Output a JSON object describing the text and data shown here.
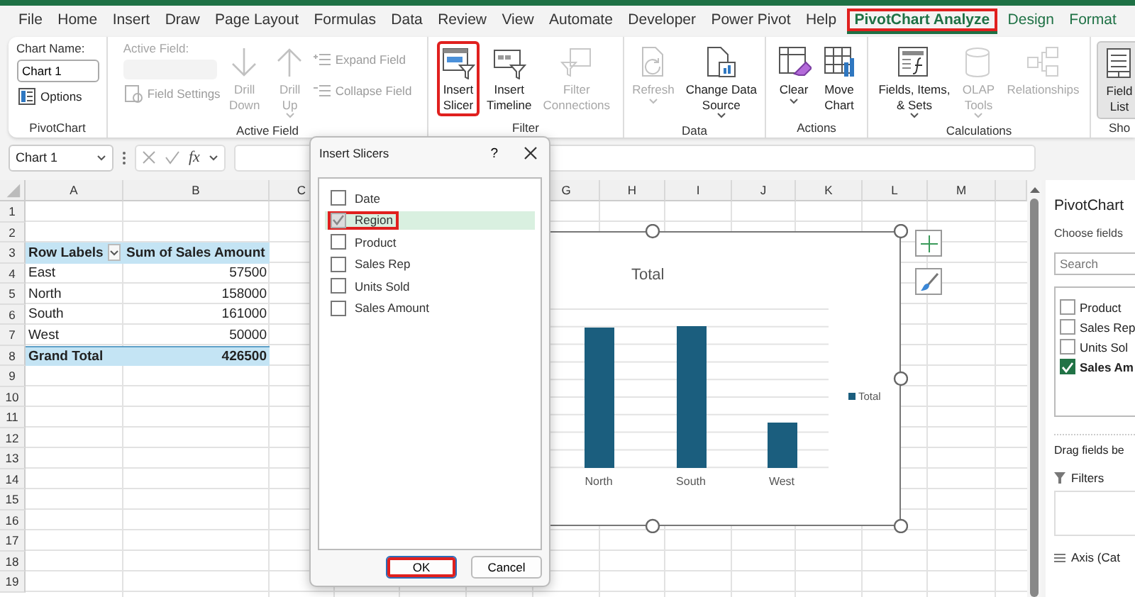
{
  "menu": [
    {
      "label": "File",
      "selected": false,
      "contextual": false,
      "highlighted": false
    },
    {
      "label": "Home",
      "selected": false,
      "contextual": false,
      "highlighted": false
    },
    {
      "label": "Insert",
      "selected": false,
      "contextual": false,
      "highlighted": false
    },
    {
      "label": "Draw",
      "selected": false,
      "contextual": false,
      "highlighted": false
    },
    {
      "label": "Page Layout",
      "selected": false,
      "contextual": false,
      "highlighted": false
    },
    {
      "label": "Formulas",
      "selected": false,
      "contextual": false,
      "highlighted": false
    },
    {
      "label": "Data",
      "selected": false,
      "contextual": false,
      "highlighted": false
    },
    {
      "label": "Review",
      "selected": false,
      "contextual": false,
      "highlighted": false
    },
    {
      "label": "View",
      "selected": false,
      "contextual": false,
      "highlighted": false
    },
    {
      "label": "Automate",
      "selected": false,
      "contextual": false,
      "highlighted": false
    },
    {
      "label": "Developer",
      "selected": false,
      "contextual": false,
      "highlighted": false
    },
    {
      "label": "Power Pivot",
      "selected": false,
      "contextual": false,
      "highlighted": false
    },
    {
      "label": "Help",
      "selected": false,
      "contextual": false,
      "highlighted": false
    },
    {
      "label": "PivotChart Analyze",
      "selected": true,
      "contextual": true,
      "highlighted": true
    },
    {
      "label": "Design",
      "selected": false,
      "contextual": true,
      "highlighted": false
    },
    {
      "label": "Format",
      "selected": false,
      "contextual": true,
      "highlighted": false
    }
  ],
  "ribbon": {
    "groups": [
      {
        "kind": "chartname",
        "label": "PivotChart",
        "name_label": "Chart Name:",
        "name_value": "Chart 1",
        "options": "Options"
      },
      {
        "kind": "activefield",
        "label": "Active Field",
        "field_label": "Active Field:",
        "settings": "Field Settings",
        "disabled": true,
        "buttons": [
          {
            "label": "Drill\nDown",
            "disabled": true,
            "dropdown": false,
            "highlighted": false,
            "pressed": false
          },
          {
            "label": "Drill\nUp",
            "disabled": true,
            "dropdown": true,
            "highlighted": false,
            "pressed": false
          }
        ],
        "small": [
          {
            "label": "Expand Field",
            "disabled": true
          },
          {
            "label": "Collapse Field",
            "disabled": true
          }
        ]
      },
      {
        "kind": "buttons",
        "label": "Filter",
        "buttons": [
          {
            "label": "Insert\nSlicer",
            "disabled": false,
            "dropdown": false,
            "highlighted": true,
            "pressed": false
          },
          {
            "label": "Insert\nTimeline",
            "disabled": false,
            "dropdown": false,
            "highlighted": false,
            "pressed": false
          },
          {
            "label": "Filter\nConnections",
            "disabled": true,
            "dropdown": false,
            "highlighted": false,
            "pressed": false
          }
        ]
      },
      {
        "kind": "buttons",
        "label": "Data",
        "buttons": [
          {
            "label": "Refresh",
            "disabled": true,
            "dropdown": true,
            "highlighted": false,
            "pressed": false
          },
          {
            "label": "Change Data\nSource",
            "disabled": false,
            "dropdown": true,
            "highlighted": false,
            "pressed": false
          }
        ]
      },
      {
        "kind": "buttons",
        "label": "Actions",
        "buttons": [
          {
            "label": "Clear",
            "disabled": false,
            "dropdown": true,
            "highlighted": false,
            "pressed": false
          },
          {
            "label": "Move\nChart",
            "disabled": false,
            "dropdown": false,
            "highlighted": false,
            "pressed": false
          }
        ]
      },
      {
        "kind": "buttons",
        "label": "Calculations",
        "buttons": [
          {
            "label": "Fields, Items,\n& Sets",
            "disabled": false,
            "dropdown": true,
            "highlighted": false,
            "pressed": false
          },
          {
            "label": "OLAP\nTools",
            "disabled": true,
            "dropdown": true,
            "highlighted": false,
            "pressed": false
          },
          {
            "label": "Relationships",
            "disabled": true,
            "dropdown": false,
            "highlighted": false,
            "pressed": false
          }
        ]
      },
      {
        "kind": "buttons",
        "label": "Sho",
        "buttons": [
          {
            "label": "Field\nList",
            "disabled": false,
            "dropdown": false,
            "highlighted": false,
            "pressed": true
          }
        ]
      }
    ]
  },
  "formula_bar": {
    "name_box": "Chart 1",
    "fx": "fx"
  },
  "sheet": {
    "columns": [
      "A",
      "B",
      "C",
      "G",
      "H",
      "I",
      "J",
      "K",
      "L",
      "M"
    ],
    "rows": [
      "1",
      "2",
      "3",
      "4",
      "5",
      "6",
      "7",
      "8",
      "9",
      "10",
      "11",
      "12",
      "13",
      "14",
      "15",
      "16",
      "17",
      "18",
      "19"
    ],
    "pivot": {
      "header": [
        "Row Labels",
        "Sum of Sales Amount"
      ],
      "rows": [
        [
          "East",
          "57500"
        ],
        [
          "North",
          "158000"
        ],
        [
          "South",
          "161000"
        ],
        [
          "West",
          "50000"
        ]
      ],
      "total": [
        "Grand Total",
        "426500"
      ]
    }
  },
  "chart": {
    "title": "Total",
    "categories": [
      "North",
      "South",
      "West"
    ],
    "legend": "Total"
  },
  "dialog": {
    "title": "Insert Slicers",
    "help": "?",
    "fields": [
      {
        "label": "Date",
        "checked": false,
        "selected": false,
        "highlighted": false
      },
      {
        "label": "Region",
        "checked": true,
        "selected": true,
        "highlighted": true
      },
      {
        "label": "Product",
        "checked": false,
        "selected": false,
        "highlighted": false
      },
      {
        "label": "Sales Rep",
        "checked": false,
        "selected": false,
        "highlighted": false
      },
      {
        "label": "Units Sold",
        "checked": false,
        "selected": false,
        "highlighted": false
      },
      {
        "label": "Sales Amount",
        "checked": false,
        "selected": false,
        "highlighted": false
      }
    ],
    "buttons": [
      {
        "label": "OK",
        "default": true,
        "highlighted": true
      },
      {
        "label": "Cancel",
        "default": false,
        "highlighted": false
      }
    ]
  },
  "pane": {
    "title": "PivotChart",
    "subtitle": "Choose fields",
    "search_placeholder": "Search",
    "fields": [
      {
        "label": "Product",
        "checked": false
      },
      {
        "label": "Sales Rep",
        "checked": false
      },
      {
        "label": "Units Sol",
        "checked": false
      },
      {
        "label": "Sales Am",
        "checked": true
      }
    ],
    "hint": "Drag fields be",
    "areas": [
      {
        "label": "Filters",
        "kind": "filters"
      },
      {
        "label": "Axis (Cat",
        "kind": "axis"
      }
    ]
  }
}
